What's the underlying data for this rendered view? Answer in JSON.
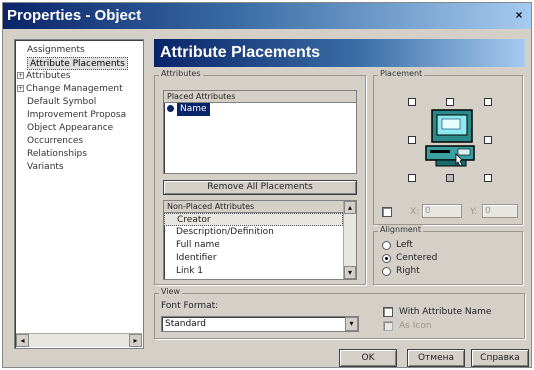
{
  "window": {
    "title": "Properties - Object",
    "close": "×"
  },
  "tree": {
    "items": [
      {
        "label": "Assignments",
        "expand": ""
      },
      {
        "label": "Attribute Placements",
        "expand": ""
      },
      {
        "label": "Attributes",
        "expand": "+"
      },
      {
        "label": "Change Management",
        "expand": "+"
      },
      {
        "label": "Default Symbol",
        "expand": ""
      },
      {
        "label": "Improvement Proposa",
        "expand": ""
      },
      {
        "label": "Object Appearance",
        "expand": ""
      },
      {
        "label": "Occurrences",
        "expand": ""
      },
      {
        "label": "Relationships",
        "expand": ""
      },
      {
        "label": "Variants",
        "expand": ""
      }
    ],
    "scroll_left": "◂",
    "scroll_right": "▸"
  },
  "banner": {
    "title": "Attribute Placements"
  },
  "attributes": {
    "group_label": "Attributes",
    "placed_header": "Placed Attributes",
    "placed": [
      "Name"
    ],
    "remove_button": "Remove All Placements",
    "nonplaced_header": "Non-Placed Attributes",
    "nonplaced": [
      "Creator",
      "Description/Definition",
      "Full name",
      "Identifier",
      "Link 1"
    ],
    "scroll_up": "▴",
    "scroll_down": "▾"
  },
  "placement": {
    "group_label": "Placement",
    "x_label": "X:",
    "y_label": "Y:",
    "x_value": "0",
    "y_value": "0"
  },
  "alignment": {
    "group_label": "Alignment",
    "options": [
      "Left",
      "Centered",
      "Right"
    ],
    "selected": "Centered"
  },
  "view": {
    "group_label": "View",
    "font_format_label": "Font Format:",
    "font_format_value": "Standard",
    "combo_arrow": "▾",
    "with_attr_name": "With Attribute Name",
    "as_icon": "As Icon"
  },
  "buttons": {
    "ok": "OK",
    "cancel": "Отмена",
    "help": "Справка"
  }
}
